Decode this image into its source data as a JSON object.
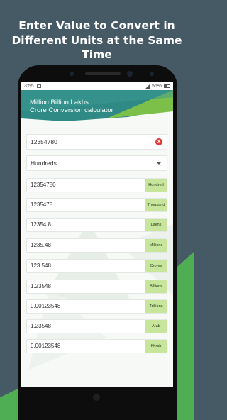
{
  "promo": {
    "line1": "Enter Value to Convert in",
    "line2": "Different Units at the Same",
    "line3": "Time"
  },
  "status_bar": {
    "time": "3:55",
    "battery": "55%"
  },
  "app": {
    "title_line1": "Million Billion Lakhs",
    "title_line2": "Crore Conversion calculator"
  },
  "input": {
    "value": "12354780"
  },
  "unit_select": {
    "selected": "Hundreds"
  },
  "results": [
    {
      "value": "12354780",
      "unit": "Hundred"
    },
    {
      "value": "1235478",
      "unit": "Thousand"
    },
    {
      "value": "12354.8",
      "unit": "Lakhs"
    },
    {
      "value": "1235.48",
      "unit": "Millions"
    },
    {
      "value": "123.548",
      "unit": "Crores"
    },
    {
      "value": "1.23548",
      "unit": "Billions"
    },
    {
      "value": "0.00123548",
      "unit": "Trillions"
    },
    {
      "value": "1.23548",
      "unit": "Arab"
    },
    {
      "value": "0.00123548",
      "unit": "Khrab"
    }
  ],
  "colors": {
    "background": "#465a66",
    "header_teal": "#2f8a85",
    "accent_green": "#7cc04a",
    "unit_chip": "#c7e69b"
  }
}
